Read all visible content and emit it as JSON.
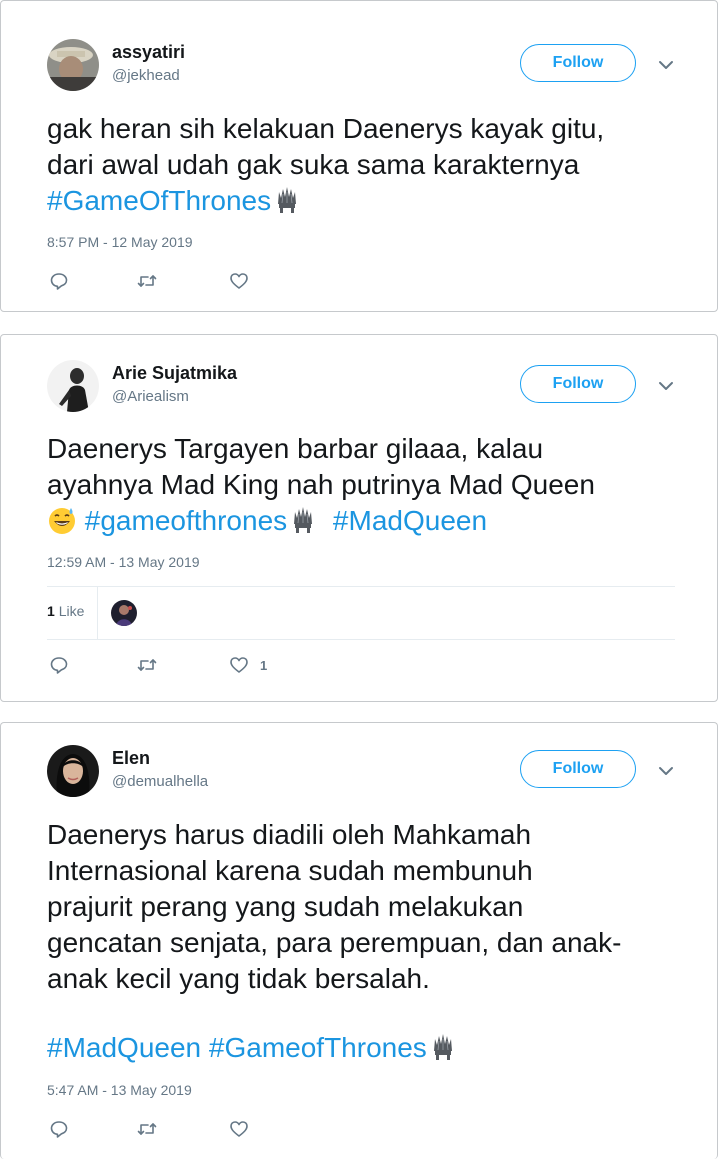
{
  "colors": {
    "link": "#1b95e0",
    "follow": "#1da1f2",
    "muted": "#657786",
    "text": "#14171a"
  },
  "tweets": [
    {
      "author": {
        "name": "assyatiri",
        "handle": "@jekhead"
      },
      "follow_label": "Follow",
      "text_lines": [
        "gak heran sih kelakuan Daenerys kayak gitu,",
        "dari awal udah gak suka sama karakternya"
      ],
      "hashtags": [
        "#GameOfThrones"
      ],
      "timestamp": "8:57 PM - 12 May 2019",
      "like_count": ""
    },
    {
      "author": {
        "name": "Arie Sujatmika",
        "handle": "@Ariealism"
      },
      "follow_label": "Follow",
      "text_lines": [
        "Daenerys Targayen barbar gilaaa, kalau",
        "ayahnya Mad King nah putrinya Mad Queen"
      ],
      "hashtags": [
        "#gameofthrones",
        "#MadQueen"
      ],
      "timestamp": "12:59 AM - 13 May 2019",
      "likes_stat": {
        "count": "1",
        "label": "Like"
      },
      "like_count": "1"
    },
    {
      "author": {
        "name": "Elen",
        "handle": "@demualhella"
      },
      "follow_label": "Follow",
      "text_lines": [
        "Daenerys harus diadili oleh Mahkamah",
        "Internasional karena sudah membunuh",
        "prajurit perang yang sudah melakukan",
        "gencatan senjata, para perempuan, dan anak-",
        "anak kecil yang tidak bersalah."
      ],
      "hashtags": [
        "#MadQueen",
        "#GameofThrones"
      ],
      "timestamp": "5:47 AM - 13 May 2019",
      "like_count": ""
    }
  ]
}
